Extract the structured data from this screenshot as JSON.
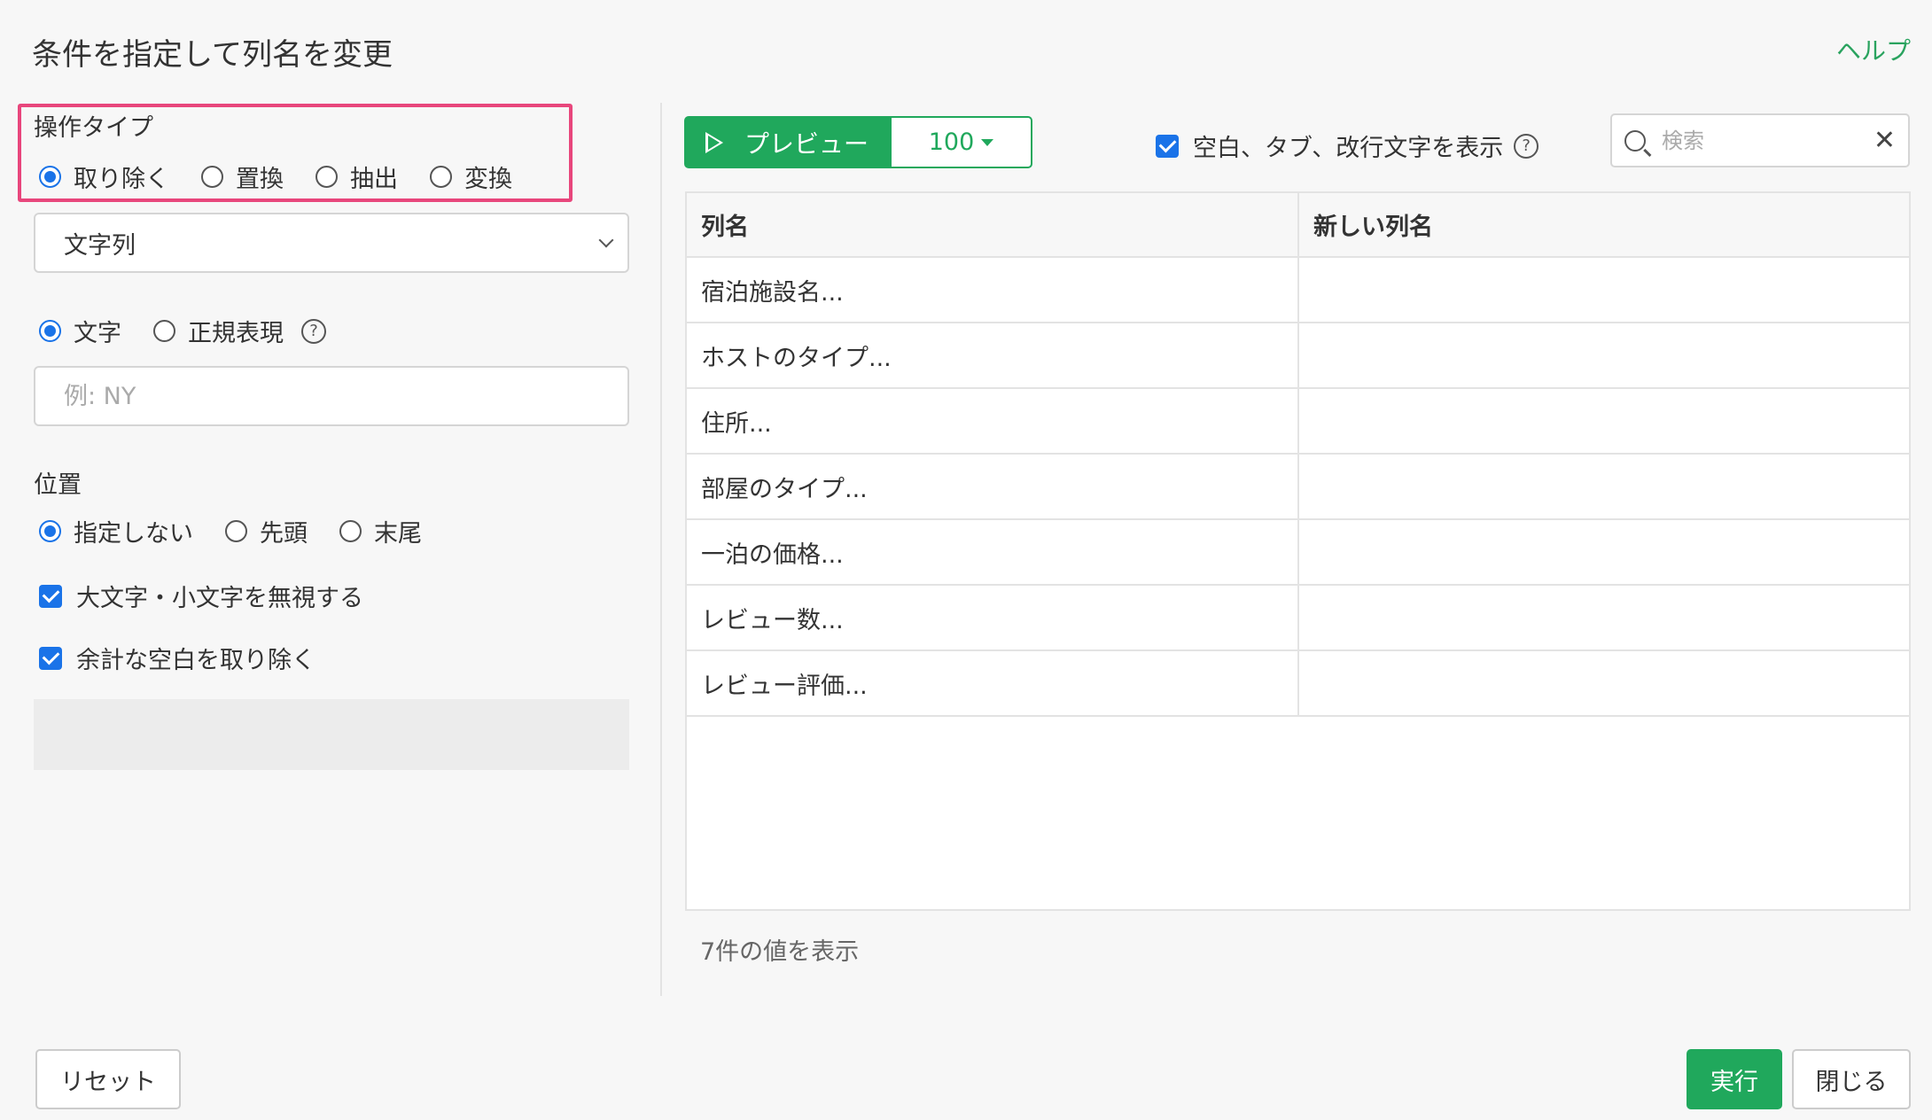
{
  "dialog": {
    "title": "条件を指定して列名を変更",
    "help_link": "ヘルプ"
  },
  "left": {
    "operation_type": {
      "label": "操作タイプ",
      "options": [
        "取り除く",
        "置換",
        "抽出",
        "変換"
      ],
      "selected": "取り除く"
    },
    "target_select": {
      "value": "文字列"
    },
    "match_mode": {
      "options": [
        "文字",
        "正規表現"
      ],
      "selected": "文字"
    },
    "pattern_input": {
      "value": "",
      "placeholder": "例: NY"
    },
    "position": {
      "label": "位置",
      "options": [
        "指定しない",
        "先頭",
        "末尾"
      ],
      "selected": "指定しない"
    },
    "ignore_case": {
      "label": "大文字・小文字を無視する",
      "checked": true
    },
    "trim_spaces": {
      "label": "余計な空白を取り除く",
      "checked": true
    }
  },
  "right": {
    "preview_button": "プレビュー",
    "row_count_button": "100",
    "show_whitespace": {
      "label": "空白、タブ、改行文字を表示",
      "checked": true
    },
    "search": {
      "value": "",
      "placeholder": "検索"
    },
    "table": {
      "headers": [
        "列名",
        "新しい列名"
      ],
      "rows": [
        [
          "宿泊施設名...",
          ""
        ],
        [
          "ホストのタイプ...",
          ""
        ],
        [
          "住所...",
          ""
        ],
        [
          "部屋のタイプ...",
          ""
        ],
        [
          "一泊の価格...",
          ""
        ],
        [
          "レビュー数...",
          ""
        ],
        [
          "レビュー評価...",
          ""
        ]
      ]
    },
    "footer_count": "7件の値を表示"
  },
  "buttons": {
    "reset": "リセット",
    "run": "実行",
    "close": "閉じる"
  },
  "colors": {
    "accent_green": "#20a85c",
    "radio_blue": "#1a73e8",
    "highlight_pink": "#e8467c"
  }
}
